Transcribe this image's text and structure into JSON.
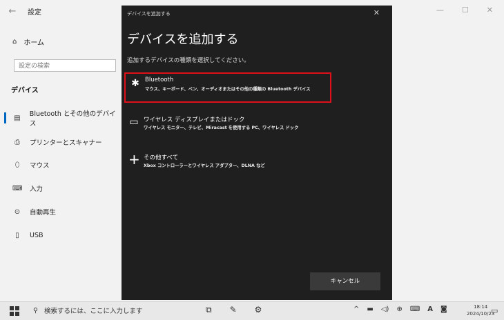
{
  "settings": {
    "back_glyph": "←",
    "title": "設定",
    "home": "ホーム",
    "search_placeholder": "設定の検索",
    "section": "デバイス",
    "nav": [
      {
        "icon": "▤",
        "label": "Bluetooth とその他のデバイス",
        "icon_name": "devices-icon"
      },
      {
        "icon": "⎙",
        "label": "プリンターとスキャナー",
        "icon_name": "printer-icon"
      },
      {
        "icon": "⬯",
        "label": "マウス",
        "icon_name": "mouse-icon"
      },
      {
        "icon": "⌨",
        "label": "入力",
        "icon_name": "keyboard-icon"
      },
      {
        "icon": "⊙",
        "label": "自動再生",
        "icon_name": "autoplay-icon"
      },
      {
        "icon": "▯",
        "label": "USB",
        "icon_name": "usb-icon"
      }
    ],
    "window_controls": {
      "minimize": "—",
      "maximize": "☐",
      "close": "✕"
    }
  },
  "dialog": {
    "titlebar": "デバイスを追加する",
    "close": "✕",
    "heading": "デバイスを追加する",
    "subtitle": "追加するデバイスの種類を選択してください。",
    "options": [
      {
        "icon": "✱",
        "icon_name": "bluetooth-icon",
        "title": "Bluetooth",
        "desc": "マウス、キーボード、ペン、オーディオまたはその他の種類の Bluetooth デバイス"
      },
      {
        "icon": "▭",
        "icon_name": "display-icon",
        "title": "ワイヤレス ディスプレイまたはドック",
        "desc": "ワイヤレス モニター、テレビ、Miracast を使用する PC、ワイヤレス ドック"
      },
      {
        "icon": "+",
        "icon_name": "plus-icon",
        "title": "その他すべて",
        "desc": "Xbox コントローラーとワイヤレス アダプター、DLNA など"
      }
    ],
    "cancel": "キャンセル",
    "highlight_color": "#e0111a"
  },
  "taskbar": {
    "search_icon": "⚲",
    "search_text": "検索するには、ここに入力します",
    "apps": [
      {
        "icon": "⧉",
        "name": "task-view-icon"
      },
      {
        "icon": "✎",
        "name": "app-icon"
      },
      {
        "icon": "⚙",
        "name": "settings-taskbar-icon"
      }
    ],
    "tray": [
      {
        "icon": "^",
        "name": "tray-chevron-icon"
      },
      {
        "icon": "▬",
        "name": "battery-icon"
      },
      {
        "icon": "◁)",
        "name": "volume-icon"
      },
      {
        "icon": "⊕",
        "name": "network-icon"
      },
      {
        "icon": "⌨",
        "name": "touch-keyboard-icon"
      },
      {
        "icon": "A",
        "name": "ime-indicator"
      },
      {
        "icon": "◙",
        "name": "ime-mode-icon"
      }
    ],
    "time": "18:14",
    "date": "2024/10/23",
    "notification_icon": "▭"
  }
}
